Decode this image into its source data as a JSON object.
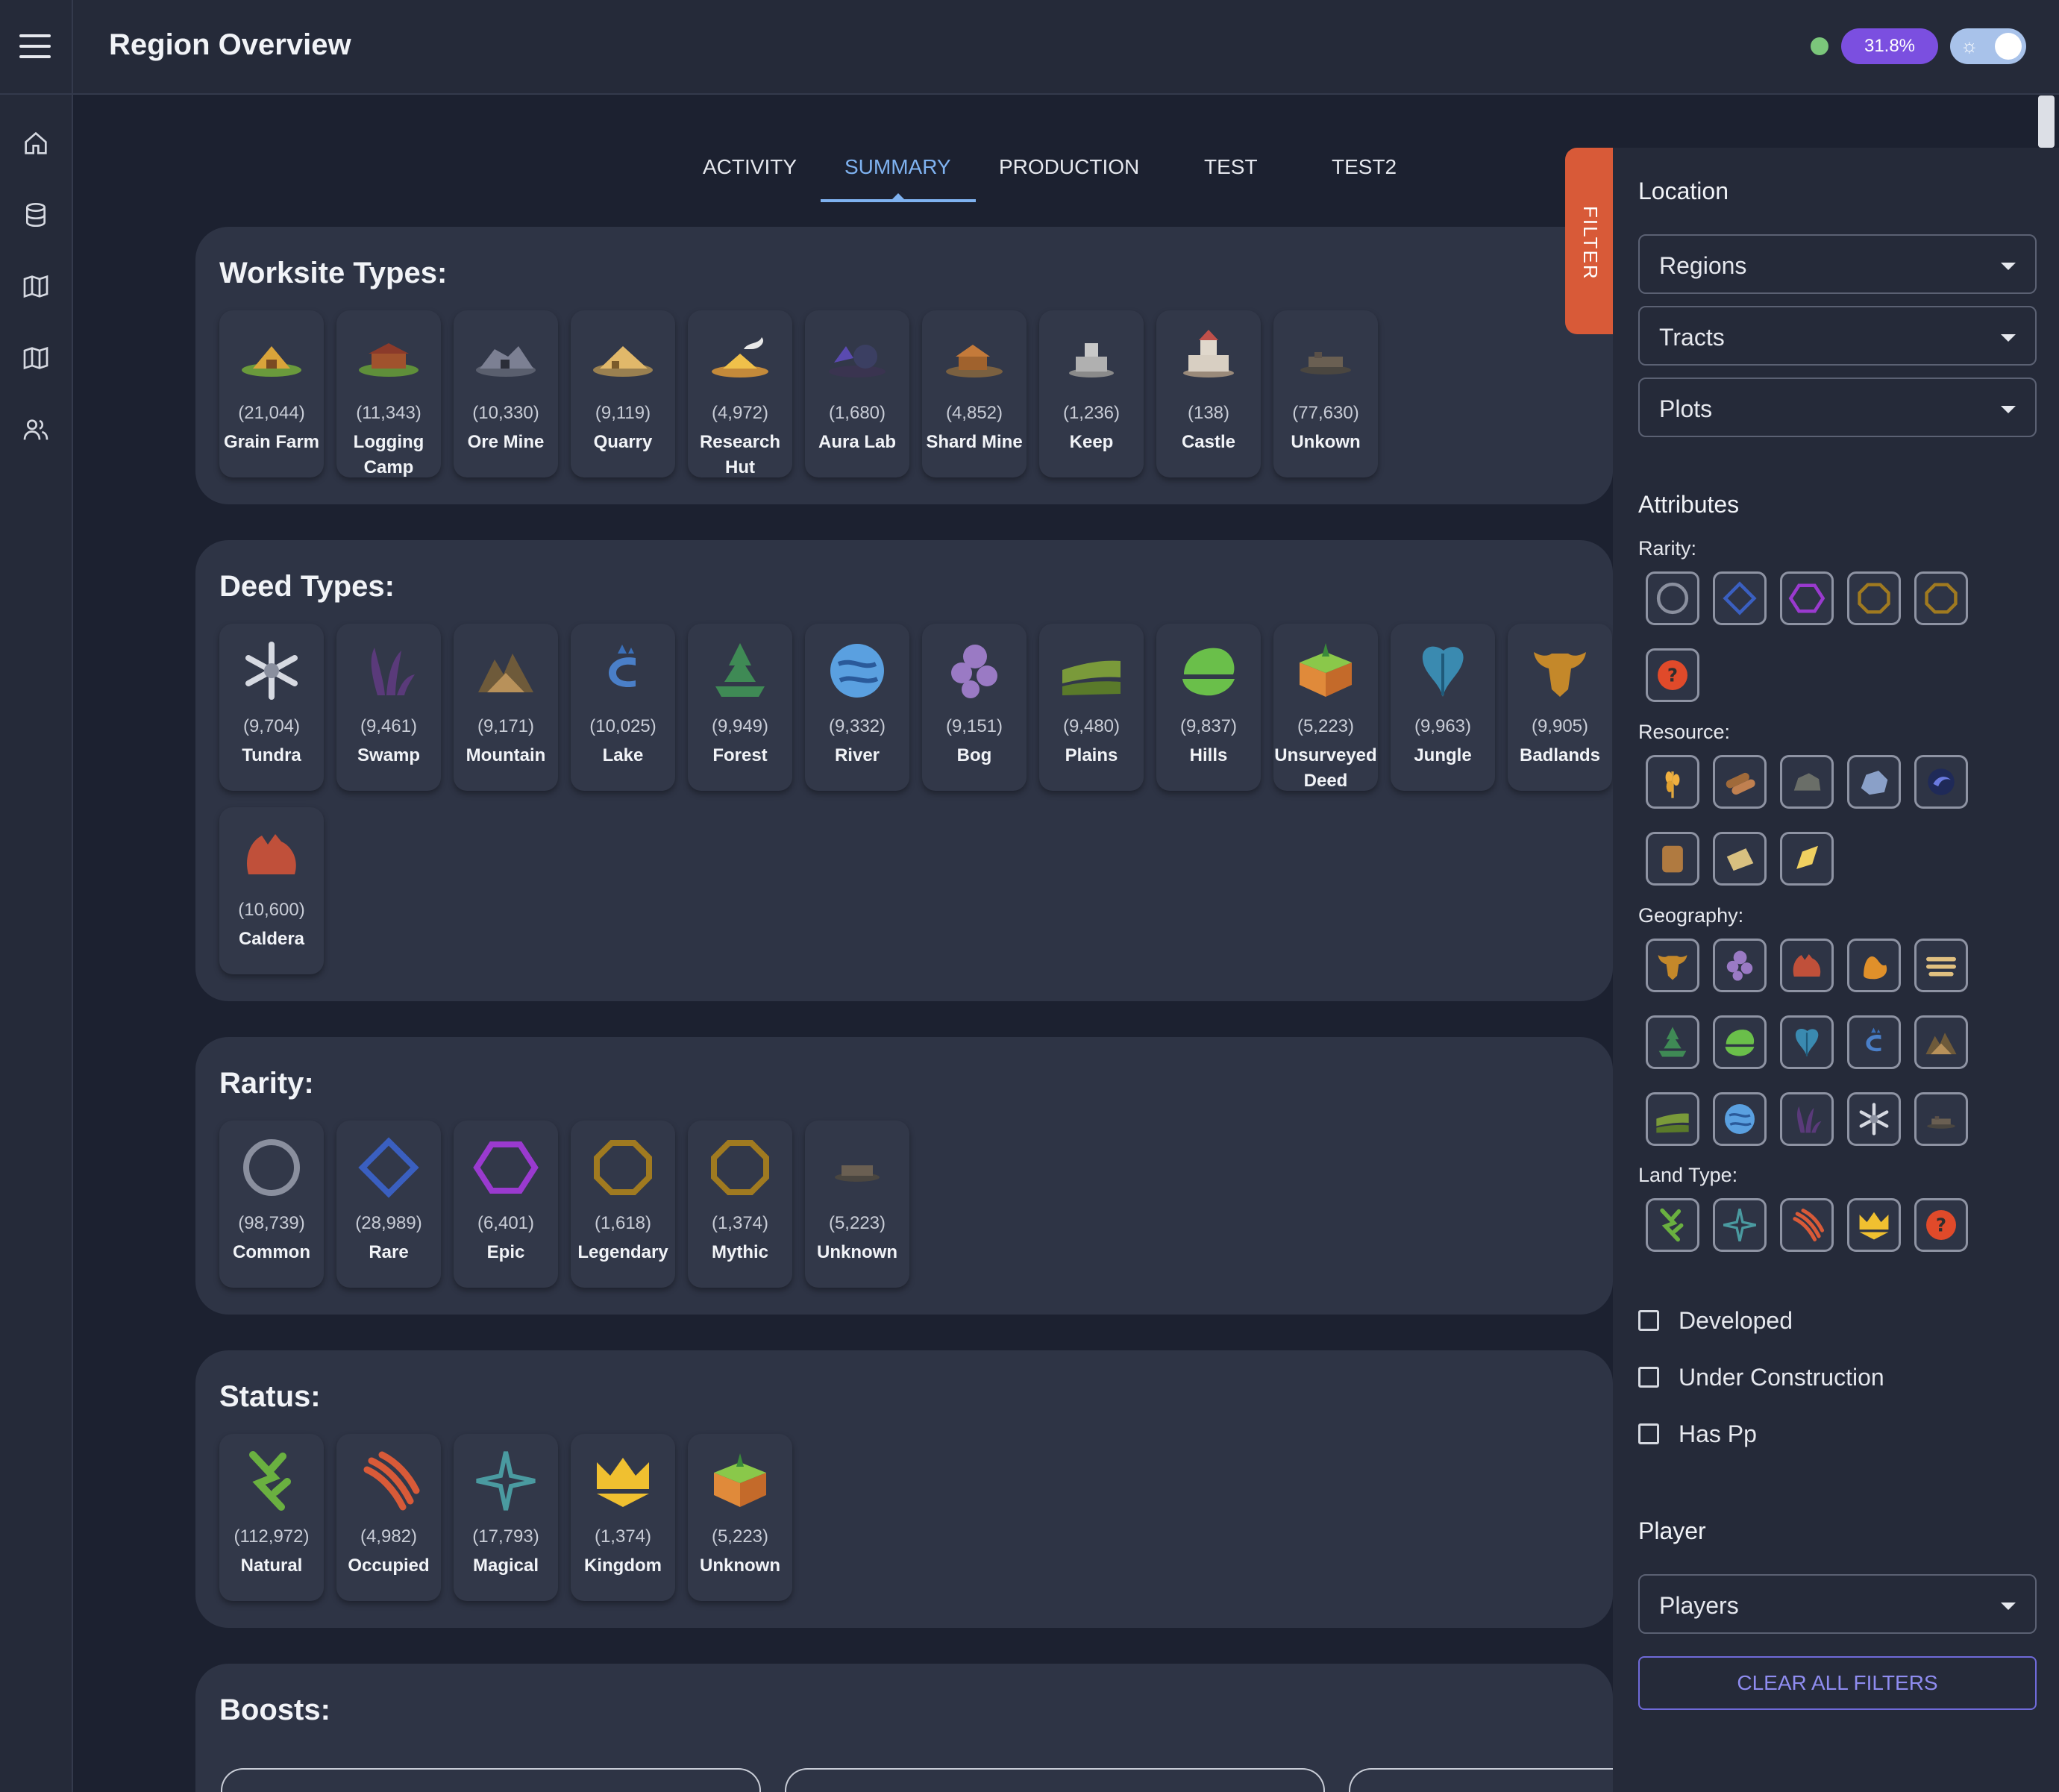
{
  "app": {
    "title": "Region Overview",
    "progress_label": "31.8%",
    "progress_percent": 31.8
  },
  "nav": {
    "items": [
      "home-icon",
      "database-icon",
      "map-icon",
      "map-alt-icon",
      "users-icon"
    ]
  },
  "tabs": [
    {
      "label": "ACTIVITY",
      "active": false
    },
    {
      "label": "SUMMARY",
      "active": true
    },
    {
      "label": "PRODUCTION",
      "active": false
    },
    {
      "label": "TEST",
      "active": false
    },
    {
      "label": "TEST2",
      "active": false
    }
  ],
  "worksite": {
    "title": "Worksite Types:",
    "items": [
      {
        "count": "(21,044)",
        "label": "Grain Farm",
        "icon": "grain-farm-icon"
      },
      {
        "count": "(11,343)",
        "label": "Logging Camp",
        "icon": "logging-camp-icon"
      },
      {
        "count": "(10,330)",
        "label": "Ore Mine",
        "icon": "ore-mine-icon"
      },
      {
        "count": "(9,119)",
        "label": "Quarry",
        "icon": "quarry-icon"
      },
      {
        "count": "(4,972)",
        "label": "Research Hut",
        "icon": "research-hut-icon"
      },
      {
        "count": "(1,680)",
        "label": "Aura Lab",
        "icon": "aura-lab-icon"
      },
      {
        "count": "(4,852)",
        "label": "Shard Mine",
        "icon": "shard-mine-icon"
      },
      {
        "count": "(1,236)",
        "label": "Keep",
        "icon": "keep-icon"
      },
      {
        "count": "(138)",
        "label": "Castle",
        "icon": "castle-icon"
      },
      {
        "count": "(77,630)",
        "label": "Unkown",
        "icon": "unknown-site-icon"
      }
    ]
  },
  "deed": {
    "title": "Deed Types:",
    "items": [
      {
        "count": "(9,704)",
        "label": "Tundra",
        "icon": "tundra-icon"
      },
      {
        "count": "(9,461)",
        "label": "Swamp",
        "icon": "swamp-icon"
      },
      {
        "count": "(9,171)",
        "label": "Mountain",
        "icon": "mountain-icon"
      },
      {
        "count": "(10,025)",
        "label": "Lake",
        "icon": "lake-icon"
      },
      {
        "count": "(9,949)",
        "label": "Forest",
        "icon": "forest-icon"
      },
      {
        "count": "(9,332)",
        "label": "River",
        "icon": "river-icon"
      },
      {
        "count": "(9,151)",
        "label": "Bog",
        "icon": "bog-icon"
      },
      {
        "count": "(9,480)",
        "label": "Plains",
        "icon": "plains-icon"
      },
      {
        "count": "(9,837)",
        "label": "Hills",
        "icon": "hills-icon"
      },
      {
        "count": "(5,223)",
        "label": "Unsurveyed Deed",
        "icon": "unsurveyed-deed-icon"
      },
      {
        "count": "(9,963)",
        "label": "Jungle",
        "icon": "jungle-icon"
      },
      {
        "count": "(9,905)",
        "label": "Badlands",
        "icon": "badlands-icon"
      },
      {
        "count": "(10,600)",
        "label": "Caldera",
        "icon": "caldera-icon"
      }
    ]
  },
  "rarity": {
    "title": "Rarity:",
    "items": [
      {
        "count": "(98,739)",
        "label": "Common",
        "icon": "common-circle-icon"
      },
      {
        "count": "(28,989)",
        "label": "Rare",
        "icon": "rare-diamond-icon"
      },
      {
        "count": "(6,401)",
        "label": "Epic",
        "icon": "epic-hexagon-icon"
      },
      {
        "count": "(1,618)",
        "label": "Legendary",
        "icon": "legendary-octagon-icon"
      },
      {
        "count": "(1,374)",
        "label": "Mythic",
        "icon": "mythic-octagon-icon"
      },
      {
        "count": "(5,223)",
        "label": "Unknown",
        "icon": "unknown-rarity-icon"
      }
    ]
  },
  "status": {
    "title": "Status:",
    "items": [
      {
        "count": "(112,972)",
        "label": "Natural",
        "icon": "natural-icon"
      },
      {
        "count": "(4,982)",
        "label": "Occupied",
        "icon": "occupied-icon"
      },
      {
        "count": "(17,793)",
        "label": "Magical",
        "icon": "magical-icon"
      },
      {
        "count": "(1,374)",
        "label": "Kingdom",
        "icon": "kingdom-crown-icon"
      },
      {
        "count": "(5,223)",
        "label": "Unknown",
        "icon": "unknown-status-icon"
      }
    ]
  },
  "boosts": {
    "title": "Boosts:"
  },
  "filter": {
    "tab_label": "FILTER",
    "location_heading": "Location",
    "selects": {
      "regions": "Regions",
      "tracts": "Tracts",
      "plots": "Plots",
      "players": "Players"
    },
    "attributes_heading": "Attributes",
    "rarity_label": "Rarity:",
    "resource_label": "Resource:",
    "geography_label": "Geography:",
    "land_type_label": "Land Type:",
    "checks": [
      {
        "label": "Developed",
        "checked": false
      },
      {
        "label": "Under Construction",
        "checked": false
      },
      {
        "label": "Has Pp",
        "checked": false
      }
    ],
    "player_heading": "Player",
    "clear_label": "CLEAR ALL FILTERS"
  },
  "colors": {
    "background": "#1c2130",
    "panel": "#2e3445",
    "accent_blue": "#7fb2f0",
    "filter_tab": "#d85a38",
    "progress_badge": "#7b4fe0"
  }
}
